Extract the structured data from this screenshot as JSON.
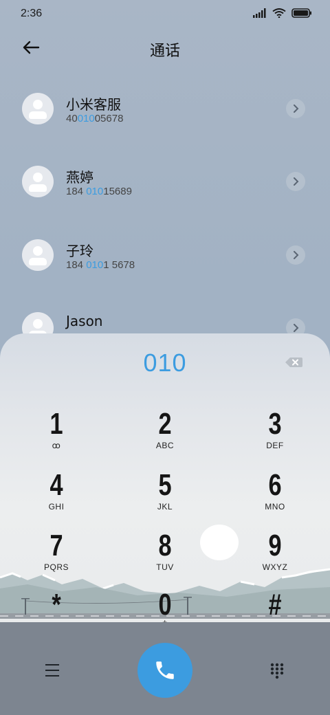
{
  "status_bar": {
    "time": "2:36"
  },
  "header": {
    "title": "通话"
  },
  "contacts": [
    {
      "name": "小米客服",
      "number_pre": "40",
      "number_hl": "010",
      "number_post": "05678"
    },
    {
      "name": "燕婷",
      "number_pre": "184 ",
      "number_hl": "010",
      "number_post": "15689"
    },
    {
      "name": "子玲",
      "number_pre": "184 ",
      "number_hl": "010",
      "number_post": "1 5678"
    },
    {
      "name": "Jason",
      "number_pre": "",
      "number_hl": "",
      "number_post": ""
    }
  ],
  "dialpad": {
    "number": "010",
    "keys": [
      {
        "digit": "1",
        "letters": "ꝏ"
      },
      {
        "digit": "2",
        "letters": "ABC"
      },
      {
        "digit": "3",
        "letters": "DEF"
      },
      {
        "digit": "4",
        "letters": "GHI"
      },
      {
        "digit": "5",
        "letters": "JKL"
      },
      {
        "digit": "6",
        "letters": "MNO"
      },
      {
        "digit": "7",
        "letters": "PQRS"
      },
      {
        "digit": "8",
        "letters": "TUV"
      },
      {
        "digit": "9",
        "letters": "WXYZ"
      },
      {
        "digit": "*",
        "letters": ","
      },
      {
        "digit": "0",
        "letters": "+"
      },
      {
        "digit": "#",
        "letters": ""
      }
    ]
  },
  "colors": {
    "accent": "#3c9ce0",
    "bottom_bar": "#7d8590"
  },
  "icons": {
    "back": "arrow-left-icon",
    "backspace": "backspace-icon",
    "call": "phone-icon",
    "menu": "menu-icon",
    "keypad": "dialpad-icon",
    "chevron": "chevron-right-icon"
  }
}
